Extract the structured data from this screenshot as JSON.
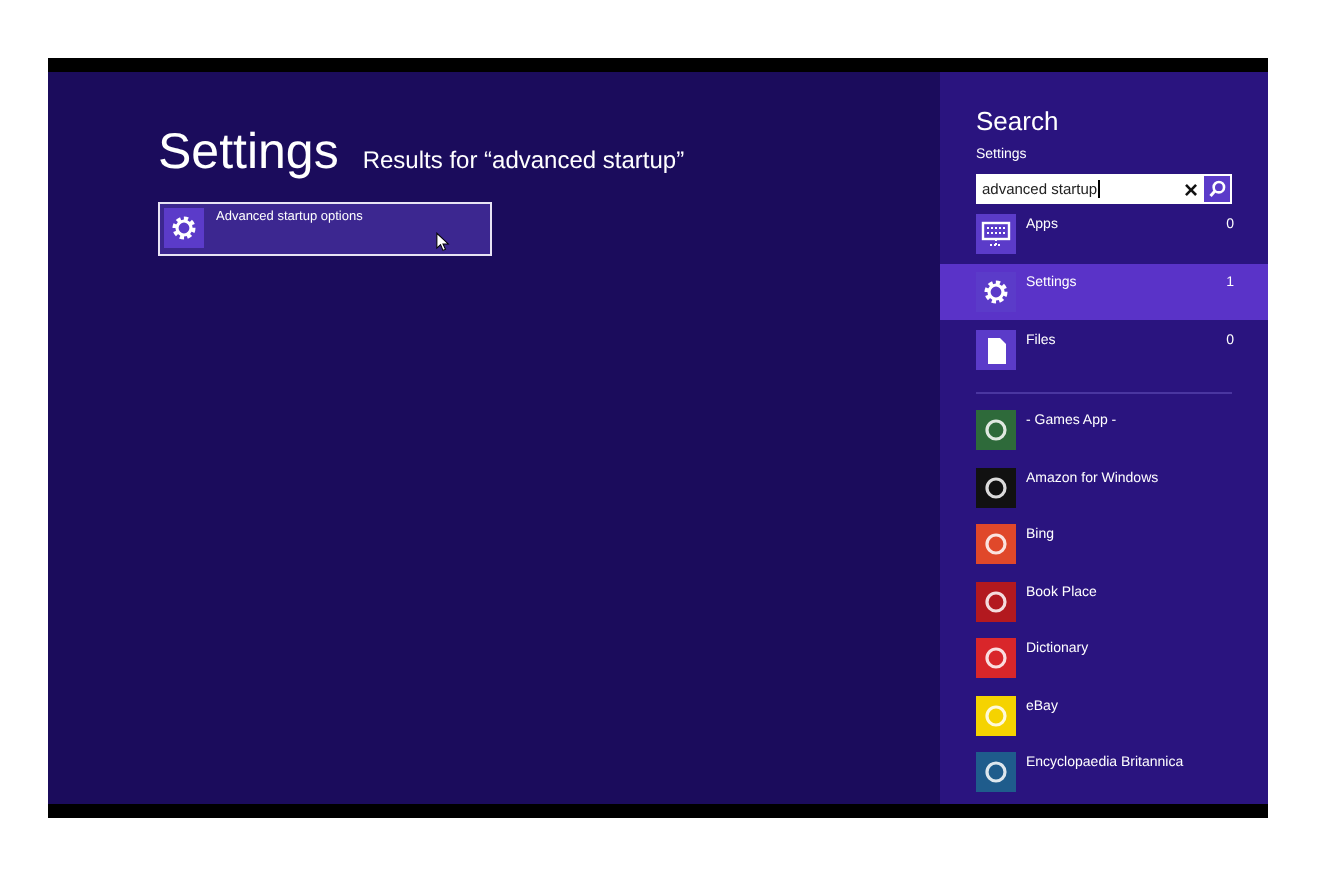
{
  "results": {
    "title": "Settings",
    "subtitle": "Results for “advanced startup”",
    "items": [
      {
        "label": "Advanced startup options",
        "selected": true
      }
    ]
  },
  "search": {
    "title": "Search",
    "scope": "Settings",
    "value": "advanced startup",
    "clear": "×"
  },
  "categories": [
    {
      "kind": "apps",
      "label": "Apps",
      "count": "0",
      "selected": false
    },
    {
      "kind": "settings",
      "label": "Settings",
      "count": "1",
      "selected": true
    },
    {
      "kind": "files",
      "label": "Files",
      "count": "0",
      "selected": false
    }
  ],
  "apps": [
    {
      "label": "- Games App -",
      "color": "#2e6a3a"
    },
    {
      "label": "Amazon for Windows",
      "color": "#111111"
    },
    {
      "label": "Bing",
      "color": "#e0482a"
    },
    {
      "label": "Book Place",
      "color": "#b3191f"
    },
    {
      "label": "Dictionary",
      "color": "#d9262a"
    },
    {
      "label": "eBay",
      "color": "#f5d300"
    },
    {
      "label": "Encyclopaedia Britannica",
      "color": "#1f5c8c"
    }
  ]
}
